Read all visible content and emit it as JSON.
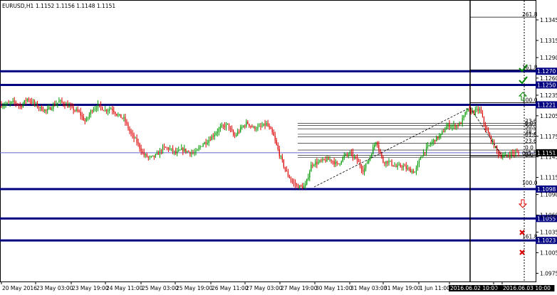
{
  "header": {
    "symbol": "EURUSD,H1",
    "ohlc": "1.1152 1.1156 1.1148 1.1151"
  },
  "colors": {
    "bull": "#009900",
    "bear": "#dd0000",
    "level_line": "#000080",
    "price_line": "#6666cc",
    "label_bg": "#000080",
    "check": "#008800",
    "cross": "#dd0000"
  },
  "chart_data": {
    "type": "candlestick",
    "instrument": "EURUSD",
    "timeframe": "H1",
    "ylim": [
      1.0963,
      1.1373
    ],
    "y_ticks": [
      "1.1345",
      "1.1315",
      "1.1290",
      "1.1260",
      "1.1235",
      "1.1205",
      "1.1175",
      "1.1145",
      "1.1115",
      "1.1090",
      "1.1060",
      "1.1035",
      "1.1005",
      "1.0975"
    ],
    "x_ticks": [
      "20 May 2016",
      "23 May 03:00",
      "23 May 19:00",
      "24 May 11:00",
      "25 May 03:00",
      "25 May 19:00",
      "26 May 11:00",
      "27 May 03:00",
      "27 May 19:00",
      "30 May 11:00",
      "31 May 03:00",
      "31 May 19:00",
      "1 Jun 11:00",
      "2016.06.02 10:00",
      "Jun",
      "2016.06.03 10:00"
    ],
    "close_path": [
      1.1221,
      1.1222,
      1.1225,
      1.1219,
      1.123,
      1.1223,
      1.1216,
      1.1212,
      1.122,
      1.1226,
      1.1221,
      1.1215,
      1.121,
      1.1196,
      1.1214,
      1.122,
      1.1213,
      1.1216,
      1.1206,
      1.12,
      1.1179,
      1.1166,
      1.1148,
      1.1143,
      1.1147,
      1.1158,
      1.1157,
      1.115,
      1.1156,
      1.1152,
      1.115,
      1.1163,
      1.1169,
      1.1179,
      1.1188,
      1.1192,
      1.1174,
      1.1186,
      1.1195,
      1.1187,
      1.1188,
      1.1193,
      1.1178,
      1.1149,
      1.1124,
      1.1108,
      1.1101,
      1.1102,
      1.1135,
      1.1137,
      1.114,
      1.1141,
      1.1133,
      1.1146,
      1.115,
      1.114,
      1.1125,
      1.1145,
      1.117,
      1.1138,
      1.1138,
      1.113,
      1.1132,
      1.1126,
      1.1123,
      1.1148,
      1.116,
      1.117,
      1.1177,
      1.1191,
      1.119,
      1.1193,
      1.1213,
      1.1211,
      1.1214,
      1.1184,
      1.1165,
      1.1148,
      1.1146,
      1.1151,
      1.1151
    ],
    "level_lines": [
      {
        "price": 1.127,
        "label": "1.1270",
        "icon": "check"
      },
      {
        "price": 1.125,
        "label": "1.1250",
        "icon": "check"
      },
      {
        "price": 1.1221,
        "label": "1.1221",
        "icon": "up-arrow"
      },
      {
        "price": 1.1098,
        "label": "1.1098",
        "icon": "down-arrow"
      },
      {
        "price": 1.1055,
        "label": "1.1055",
        "icon": "cross"
      },
      {
        "price": 1.1023,
        "label": "1.1023",
        "icon": "cross"
      }
    ],
    "current_price": {
      "price": 1.1151,
      "label": "1.1151"
    },
    "fib_upper": [
      {
        "label": "261.8",
        "price": 1.1349
      },
      {
        "label": "161.8",
        "price": 1.1272
      },
      {
        "label": "100.0",
        "price": 1.1224
      },
      {
        "label": "0.0",
        "price": 1.1146
      }
    ],
    "fib_lower": [
      {
        "label": "100.0",
        "price": 1.1103
      },
      {
        "label": "161.8",
        "price": 1.1025
      }
    ],
    "fib_retracement": [
      {
        "label": "23.6",
        "price": 1.1194
      },
      {
        "label": "0.0",
        "price": 1.1191
      },
      {
        "label": "50.0",
        "price": 1.1186
      },
      {
        "label": "38.2",
        "price": 1.1178
      },
      {
        "label": "61.8",
        "price": 1.1174
      },
      {
        "label": "23.6",
        "price": 1.1165
      },
      {
        "label": "0.0",
        "price": 1.1155
      },
      {
        "label": "61.8",
        "price": 1.1147
      },
      {
        "label": "0.0",
        "price": 1.1144
      }
    ],
    "grid": false
  }
}
